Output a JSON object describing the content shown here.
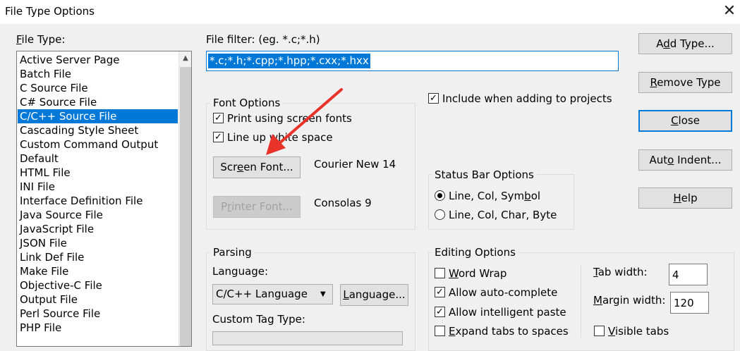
{
  "window": {
    "title": "File Type Options",
    "close_glyph": "✕"
  },
  "file_type": {
    "label_u": "F",
    "label_rest": "ile Type:",
    "items": [
      "Active Server Page",
      "Batch File",
      "C Source File",
      "C# Source File",
      "C/C++ Source File",
      "Cascading Style Sheet",
      "Custom Command Output",
      "Default",
      "HTML File",
      "INI File",
      "Interface Definition File",
      "Java Source File",
      "JavaScript File",
      "JSON File",
      "Link Def File",
      "Make File",
      "Objective-C File",
      "Output File",
      "Perl Source File",
      "PHP File"
    ],
    "selected": "C/C++ Source File"
  },
  "file_filter": {
    "label": "File filter: (eg. *.c;*.h)",
    "value": "*.c;*.h;*.cpp;*.hpp;*.cxx;*.hxx"
  },
  "buttons": {
    "add_type_a": "A",
    "add_type_u": "d",
    "add_type_b": "d Type...",
    "remove_type_u": "R",
    "remove_type_b": "emove Type",
    "close_u": "C",
    "close_b": "lose",
    "auto_indent_a": "Aut",
    "auto_indent_u": "o",
    "auto_indent_b": " Indent...",
    "help_u": "H",
    "help_b": "elp"
  },
  "font_options": {
    "title": "Font Options",
    "print_screen_fonts": "Print using screen fonts",
    "line_up_white_space": "Line up white space",
    "screen_font_a": "Scr",
    "screen_font_u": "e",
    "screen_font_b": "en Font...",
    "screen_font_value": "Courier New 14",
    "printer_font_a": "P",
    "printer_font_u": "r",
    "printer_font_b": "inter Font...",
    "printer_font_value": "Consolas 9"
  },
  "include_projects": {
    "label": "Include when adding to projects",
    "checked": true
  },
  "status_bar": {
    "title": "Status Bar Options",
    "opt1_a": "Line, Col, Sym",
    "opt1_u": "b",
    "opt1_b": "ol",
    "opt2": "Line, Col, Char, Byte",
    "selected": "Line, Col, Symbol"
  },
  "parsing": {
    "title": "Parsing",
    "language_label": "Language:",
    "language_value": "C/C++ Language",
    "language_btn_u": "L",
    "language_btn_b": "anguage...",
    "custom_tag_label": "Custom Tag Type:"
  },
  "editing": {
    "title": "Editing Options",
    "word_wrap_u": "W",
    "word_wrap_b": "ord Wrap",
    "auto_complete": "Allow auto-complete",
    "intelligent_paste": "Allow intelligent paste",
    "expand_tabs_u": "E",
    "expand_tabs_b": "xpand tabs to spaces",
    "tab_width_u": "T",
    "tab_width_b": "ab width:",
    "tab_width_value": "4",
    "margin_width_u": "M",
    "margin_width_b": "argin width:",
    "margin_width_value": "120",
    "visible_tabs_u": "V",
    "visible_tabs_b": "isible tabs"
  },
  "check_glyph": "✓",
  "arrow_color": "#e8322a",
  "accent_color": "#0078d7"
}
